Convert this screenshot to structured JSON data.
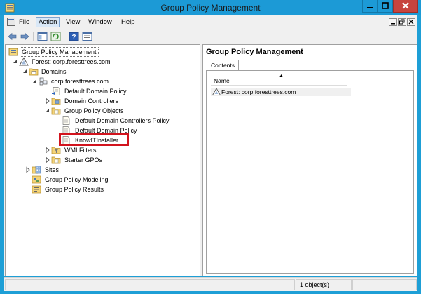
{
  "window": {
    "title": "Group Policy Management",
    "accent_color": "#1c9ad6",
    "close_color": "#c7443e"
  },
  "menu": {
    "items": [
      "File",
      "Action",
      "View",
      "Window",
      "Help"
    ],
    "active": "Action"
  },
  "toolbar": {
    "buttons": [
      "back-arrow-icon",
      "forward-arrow-icon",
      "show-hide-tree-icon",
      "refresh-icon",
      "help-icon",
      "properties-icon"
    ]
  },
  "tree": {
    "root": "Group Policy Management",
    "forest": "Forest: corp.foresttrees.com",
    "domains": "Domains",
    "domain": "corp.foresttrees.com",
    "default_domain_policy": "Default Domain Policy",
    "domain_controllers": "Domain Controllers",
    "gpo_container": "Group Policy Objects",
    "gpo_items": [
      "Default Domain Controllers Policy",
      "Default Domain Policy",
      "KnowITInstaller"
    ],
    "wmi_filters": "WMI Filters",
    "starter_gpos": "Starter GPOs",
    "sites": "Sites",
    "modeling": "Group Policy Modeling",
    "results": "Group Policy Results",
    "highlighted_item": "KnowITInstaller",
    "highlight_color": "#d2141e"
  },
  "right_pane": {
    "title": "Group Policy Management",
    "tab": "Contents",
    "column_header": "Name",
    "rows": [
      "Forest: corp.foresttrees.com"
    ]
  },
  "status": {
    "object_count": "1 object(s)"
  }
}
